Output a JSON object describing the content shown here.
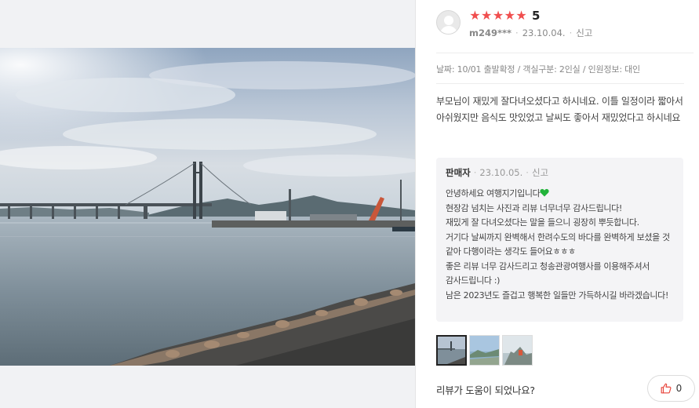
{
  "review": {
    "rating_label": "5",
    "stars_filled": 5,
    "user": "m249***",
    "date": "23.10.04.",
    "report_label": "신고",
    "options_text": "날짜: 10/01 출발확정 / 객실구분: 2인실 / 인원정보: 대인",
    "text": "부모님이 재밌게 잘다녀오셨다고 하시네요. 이틀 일정이라 짧아서 아쉬웠지만 음식도 맛있었고 날씨도 좋아서 재밌었다고 하시네요"
  },
  "seller_reply": {
    "name": "판매자",
    "date": "23.10.05.",
    "report_label": "신고",
    "greeting": "안녕하세요 여행지기입니다",
    "lines": [
      "현장감 넘치는 사진과 리뷰 너무너무 감사드립니다!",
      "재밌게 잘 다녀오셨다는 말을 들으니 굉장히 뿌듯합니다.",
      "거기다 날씨까지 완벽해서 한려수도의 바다를 완벽하게 보셨을 것 같아 다행이라는 생각도 들어요ㅎㅎㅎ",
      "좋은 리뷰 너무 감사드리고 청송관광여행사를 이용해주셔서 감사드립니다 :)",
      "남은 2023년도 즐겁고 행복한 일들만 가득하시길 바라겠습니다!"
    ]
  },
  "helpful": {
    "question": "리뷰가 도움이 되었나요?",
    "count": "0"
  },
  "colors": {
    "star": "#f04e4e",
    "heart": "#22b33a",
    "like_icon": "#e8453c"
  },
  "icons": {
    "avatar": "user-avatar-icon",
    "star": "star-icon",
    "heart": "green-heart-emoji",
    "like": "thumbs-up-icon"
  }
}
